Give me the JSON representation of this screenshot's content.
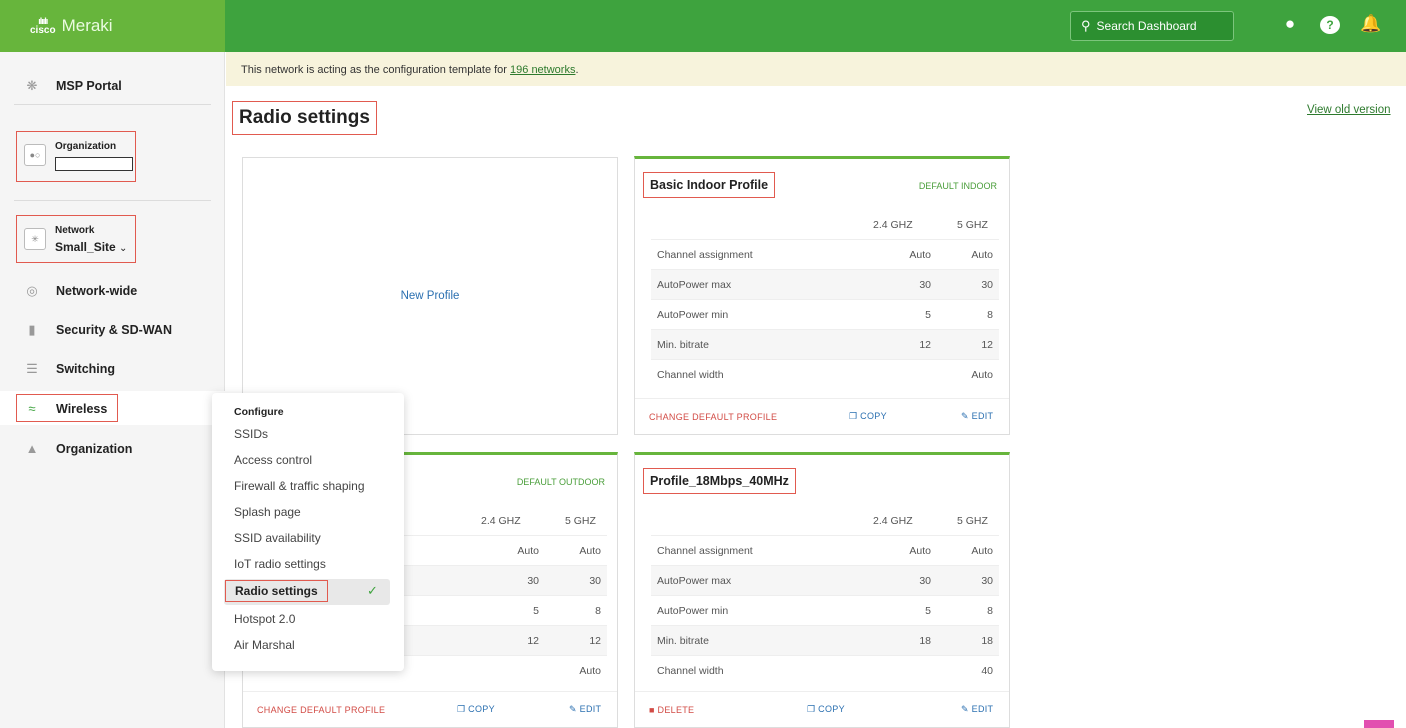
{
  "brand": {
    "cisco": "cisco",
    "name": "Meraki"
  },
  "search": {
    "placeholder": "Search Dashboard"
  },
  "sidebar": {
    "msp_portal": "MSP Portal",
    "organization_label": "Organization",
    "network_label": "Network",
    "network_value": "Small_Site",
    "items": [
      "Network-wide",
      "Security & SD-WAN",
      "Switching",
      "Wireless",
      "Organization"
    ]
  },
  "banner": {
    "text": "This network is acting as the configuration template for ",
    "link": "196 networks",
    "suffix": "."
  },
  "page": {
    "title": "Radio settings",
    "old_version": "View old version",
    "new_profile": "New Profile"
  },
  "profiles": [
    {
      "title": "Basic Indoor Profile",
      "tag": "DEFAULT INDOOR",
      "col1": "2.4 GHZ",
      "col2": "5 GHZ",
      "rows": [
        {
          "label": "Channel assignment",
          "v1": "Auto",
          "v2": "Auto"
        },
        {
          "label": "AutoPower max",
          "v1": "30",
          "v2": "30"
        },
        {
          "label": "AutoPower min",
          "v1": "5",
          "v2": "8"
        },
        {
          "label": "Min. bitrate",
          "v1": "12",
          "v2": "12"
        },
        {
          "label": "Channel width",
          "v1": "",
          "v2": "Auto"
        }
      ],
      "foot_left": "CHANGE DEFAULT PROFILE",
      "foot_copy": "COPY",
      "foot_edit": "EDIT"
    },
    {
      "title": "",
      "tag": "DEFAULT OUTDOOR",
      "col1": "2.4 GHZ",
      "col2": "5 GHZ",
      "rows": [
        {
          "label": "",
          "v1": "Auto",
          "v2": "Auto"
        },
        {
          "label": "",
          "v1": "30",
          "v2": "30"
        },
        {
          "label": "",
          "v1": "5",
          "v2": "8"
        },
        {
          "label": "",
          "v1": "12",
          "v2": "12"
        },
        {
          "label": "",
          "v1": "",
          "v2": "Auto"
        }
      ],
      "foot_left": "CHANGE DEFAULT PROFILE",
      "foot_copy": "COPY",
      "foot_edit": "EDIT"
    },
    {
      "title": "Profile_18Mbps_40MHz",
      "tag": "",
      "col1": "2.4 GHZ",
      "col2": "5 GHZ",
      "rows": [
        {
          "label": "Channel assignment",
          "v1": "Auto",
          "v2": "Auto"
        },
        {
          "label": "AutoPower max",
          "v1": "30",
          "v2": "30"
        },
        {
          "label": "AutoPower min",
          "v1": "5",
          "v2": "8"
        },
        {
          "label": "Min. bitrate",
          "v1": "18",
          "v2": "18"
        },
        {
          "label": "Channel width",
          "v1": "",
          "v2": "40"
        }
      ],
      "foot_left": "DELETE",
      "foot_copy": "COPY",
      "foot_edit": "EDIT"
    }
  ],
  "menu": {
    "header": "Configure",
    "items": [
      "SSIDs",
      "Access control",
      "Firewall & traffic shaping",
      "Splash page",
      "SSID availability",
      "IoT radio settings",
      "Radio settings",
      "Hotspot 2.0",
      "Air Marshal"
    ],
    "active": "Radio settings"
  },
  "colors": {
    "header_green": "#3ea33e",
    "accent_green": "#67b53c",
    "highlight_red": "#e15a4f",
    "link_blue": "#2a6fb0"
  }
}
